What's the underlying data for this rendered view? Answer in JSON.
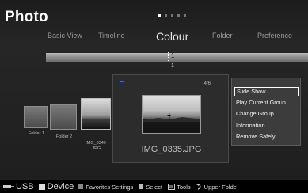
{
  "app": {
    "title": "Photo"
  },
  "tabs": [
    {
      "label": "Basic View"
    },
    {
      "label": "Timeline"
    },
    {
      "label": "Colour"
    },
    {
      "label": "Folder"
    },
    {
      "label": "Preference"
    }
  ],
  "sort_bar": {
    "value": "1",
    "value_below": "1"
  },
  "folders": [
    {
      "label": "Folder 1"
    },
    {
      "label": "Folder 2"
    }
  ],
  "thumbnail": {
    "label": "IMG_0349\n.JPG"
  },
  "preview": {
    "count": "4/6",
    "filename": "IMG_0335.JPG"
  },
  "context_menu": {
    "items": [
      {
        "label": "Slide Show"
      },
      {
        "label": "Play Current Group"
      },
      {
        "label": "Change Group"
      },
      {
        "label": "Information"
      },
      {
        "label": "Remove Safely"
      }
    ],
    "selected_index": 0
  },
  "bottom_bar": {
    "usb": "USB",
    "device": "Device",
    "favorites": "Favorites Settings",
    "select": "Select",
    "tools": "Tools",
    "upper_folder": "Upper Folde"
  },
  "colors": {
    "selection_border": "#ffffff",
    "background": "#1e1e1e"
  }
}
